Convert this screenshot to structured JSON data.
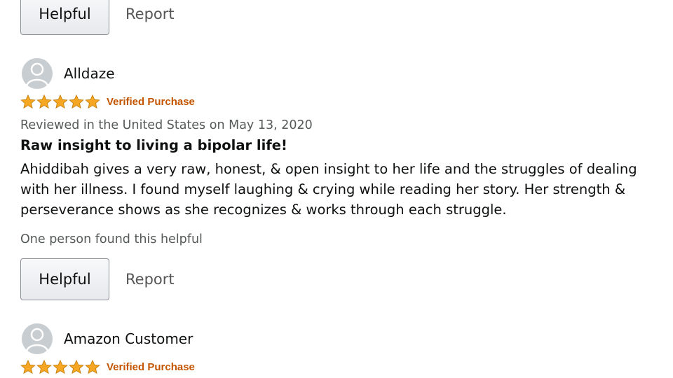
{
  "top_actions": {
    "helpful_label": "Helpful",
    "report_label": "Report"
  },
  "reviews": [
    {
      "author": "Alldaze",
      "rating": 5,
      "badge": "Verified Purchase",
      "meta": "Reviewed in the United States on May 13, 2020",
      "title": "Raw insight to living a bipolar life!",
      "body": "Ahiddibah gives a very raw, honest, & open insight to her life and the struggles of dealing with her illness. I found myself laughing & crying while reading her story. Her strength & perseverance shows as she recognizes & works through each struggle.",
      "helpful_count": "One person found this helpful",
      "helpful_label": "Helpful",
      "report_label": "Report"
    },
    {
      "author": "Amazon Customer",
      "rating": 5,
      "badge": "Verified Purchase"
    }
  ],
  "colors": {
    "star": "#f5a623",
    "verified": "#c45500",
    "meta_text": "#565959",
    "button_border": "#8d9096"
  },
  "icons": {
    "avatar": "default-user-avatar-icon",
    "star": "star-icon"
  }
}
